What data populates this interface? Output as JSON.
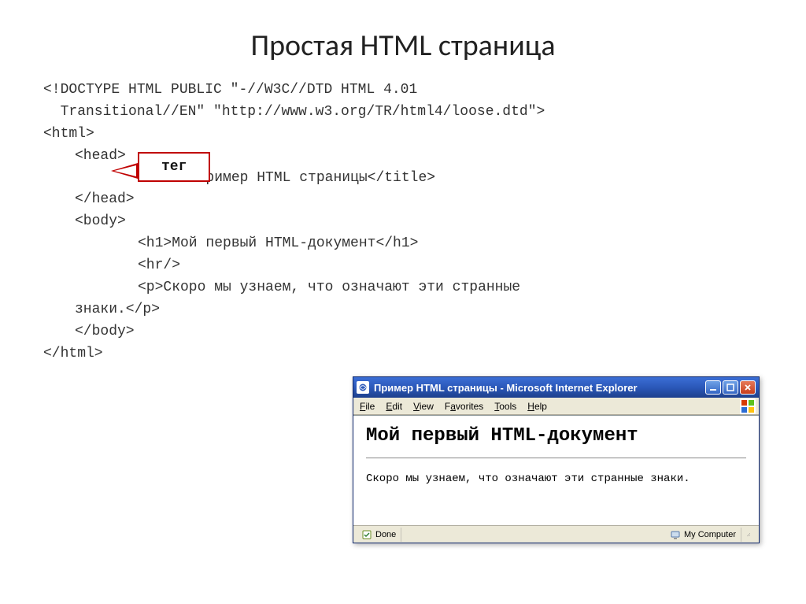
{
  "slide": {
    "title": "Простая HTML страница"
  },
  "code": {
    "doctype": "<!DOCTYPE HTML PUBLIC \"-//W3C//DTD HTML 4.01",
    "doctype2": "  Transitional//EN\" \"http://www.w3.org/TR/html4/loose.dtd\">",
    "html_open": "<html>",
    "head_open": "<head>",
    "title_line": "<title>Пример HTML страницы</title>",
    "head_close": "</head>",
    "body_open": "<body>",
    "h1_line": "<h1>Мой первый HTML-документ</h1>",
    "hr_line": "<hr/>",
    "p_line": "<p>Скоро мы узнаем, что означают эти странные",
    "p_line2": "знаки.</p>",
    "body_close": "</body>",
    "html_close": "</html>"
  },
  "callout": {
    "label": "тег"
  },
  "browser": {
    "title": "Пример HTML страницы - Microsoft Internet Explorer",
    "menu": {
      "file": "File",
      "edit": "Edit",
      "view": "View",
      "favorites": "Favorites",
      "tools": "Tools",
      "help": "Help"
    },
    "content": {
      "h1": "Мой первый HTML-документ",
      "p": "Скоро мы узнаем, что означают эти странные знаки."
    },
    "status": {
      "done": "Done",
      "zone": "My Computer"
    }
  }
}
